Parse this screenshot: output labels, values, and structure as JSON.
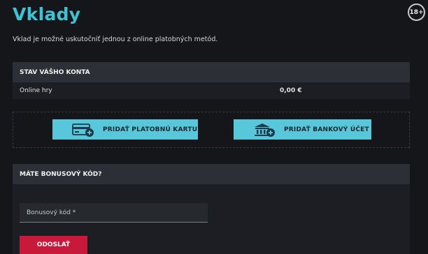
{
  "page": {
    "title": "Vklady",
    "age_badge": "18+",
    "intro": "Vklad je možné uskutočniť jednou z online platobných metód."
  },
  "account": {
    "header": "STAV VÁŠHO KONTA",
    "rows": [
      {
        "label": "Online hry",
        "amount": "0,00 €"
      }
    ]
  },
  "methods": {
    "add_card_label": "PRIDAŤ PLATOBNÚ KARTU",
    "add_card_icon": "credit-card-plus-icon",
    "add_bank_label": "PRIDAŤ BANKOVÝ ÚČET",
    "add_bank_icon": "bank-plus-icon"
  },
  "bonus": {
    "header": "MÁTE BONUSOVÝ KÓD?",
    "input_placeholder": "Bonusový kód *",
    "input_value": "",
    "submit_label": "ODOSLAŤ"
  },
  "colors": {
    "accent": "#3fc2d4",
    "button_cyan": "#58c7da",
    "submit_red": "#c8193a",
    "background": "#14161a"
  }
}
